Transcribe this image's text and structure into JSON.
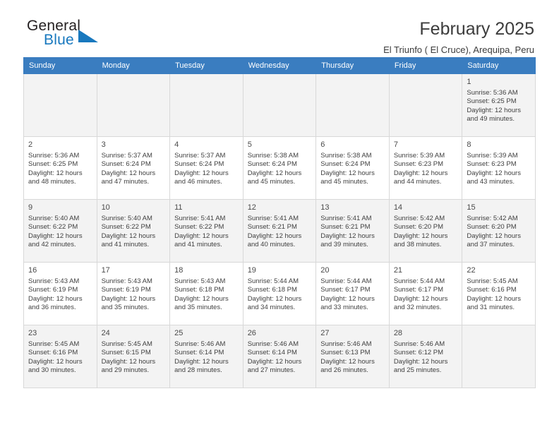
{
  "logo": {
    "primary_text": "General",
    "secondary_text": "Blue",
    "primary_color": "#231f20",
    "secondary_color": "#1878be"
  },
  "header": {
    "title": "February 2025",
    "subtitle": "El Triunfo ( El Cruce), Arequipa, Peru"
  },
  "colors": {
    "header_row_background": "#3a7dc0",
    "header_row_text": "#ffffff",
    "cell_border": "#d8d8d8",
    "shaded_row_background": "#f3f3f3"
  },
  "calendar": {
    "weekday_headers": [
      "Sunday",
      "Monday",
      "Tuesday",
      "Wednesday",
      "Thursday",
      "Friday",
      "Saturday"
    ],
    "weeks": [
      [
        {
          "day": "",
          "empty": true
        },
        {
          "day": "",
          "empty": true
        },
        {
          "day": "",
          "empty": true
        },
        {
          "day": "",
          "empty": true
        },
        {
          "day": "",
          "empty": true
        },
        {
          "day": "",
          "empty": true
        },
        {
          "day": "1",
          "sunrise": "Sunrise: 5:36 AM",
          "sunset": "Sunset: 6:25 PM",
          "daylight_line1": "Daylight: 12 hours",
          "daylight_line2": "and 49 minutes."
        }
      ],
      [
        {
          "day": "2",
          "sunrise": "Sunrise: 5:36 AM",
          "sunset": "Sunset: 6:25 PM",
          "daylight_line1": "Daylight: 12 hours",
          "daylight_line2": "and 48 minutes."
        },
        {
          "day": "3",
          "sunrise": "Sunrise: 5:37 AM",
          "sunset": "Sunset: 6:24 PM",
          "daylight_line1": "Daylight: 12 hours",
          "daylight_line2": "and 47 minutes."
        },
        {
          "day": "4",
          "sunrise": "Sunrise: 5:37 AM",
          "sunset": "Sunset: 6:24 PM",
          "daylight_line1": "Daylight: 12 hours",
          "daylight_line2": "and 46 minutes."
        },
        {
          "day": "5",
          "sunrise": "Sunrise: 5:38 AM",
          "sunset": "Sunset: 6:24 PM",
          "daylight_line1": "Daylight: 12 hours",
          "daylight_line2": "and 45 minutes."
        },
        {
          "day": "6",
          "sunrise": "Sunrise: 5:38 AM",
          "sunset": "Sunset: 6:24 PM",
          "daylight_line1": "Daylight: 12 hours",
          "daylight_line2": "and 45 minutes."
        },
        {
          "day": "7",
          "sunrise": "Sunrise: 5:39 AM",
          "sunset": "Sunset: 6:23 PM",
          "daylight_line1": "Daylight: 12 hours",
          "daylight_line2": "and 44 minutes."
        },
        {
          "day": "8",
          "sunrise": "Sunrise: 5:39 AM",
          "sunset": "Sunset: 6:23 PM",
          "daylight_line1": "Daylight: 12 hours",
          "daylight_line2": "and 43 minutes."
        }
      ],
      [
        {
          "day": "9",
          "sunrise": "Sunrise: 5:40 AM",
          "sunset": "Sunset: 6:22 PM",
          "daylight_line1": "Daylight: 12 hours",
          "daylight_line2": "and 42 minutes."
        },
        {
          "day": "10",
          "sunrise": "Sunrise: 5:40 AM",
          "sunset": "Sunset: 6:22 PM",
          "daylight_line1": "Daylight: 12 hours",
          "daylight_line2": "and 41 minutes."
        },
        {
          "day": "11",
          "sunrise": "Sunrise: 5:41 AM",
          "sunset": "Sunset: 6:22 PM",
          "daylight_line1": "Daylight: 12 hours",
          "daylight_line2": "and 41 minutes."
        },
        {
          "day": "12",
          "sunrise": "Sunrise: 5:41 AM",
          "sunset": "Sunset: 6:21 PM",
          "daylight_line1": "Daylight: 12 hours",
          "daylight_line2": "and 40 minutes."
        },
        {
          "day": "13",
          "sunrise": "Sunrise: 5:41 AM",
          "sunset": "Sunset: 6:21 PM",
          "daylight_line1": "Daylight: 12 hours",
          "daylight_line2": "and 39 minutes."
        },
        {
          "day": "14",
          "sunrise": "Sunrise: 5:42 AM",
          "sunset": "Sunset: 6:20 PM",
          "daylight_line1": "Daylight: 12 hours",
          "daylight_line2": "and 38 minutes."
        },
        {
          "day": "15",
          "sunrise": "Sunrise: 5:42 AM",
          "sunset": "Sunset: 6:20 PM",
          "daylight_line1": "Daylight: 12 hours",
          "daylight_line2": "and 37 minutes."
        }
      ],
      [
        {
          "day": "16",
          "sunrise": "Sunrise: 5:43 AM",
          "sunset": "Sunset: 6:19 PM",
          "daylight_line1": "Daylight: 12 hours",
          "daylight_line2": "and 36 minutes."
        },
        {
          "day": "17",
          "sunrise": "Sunrise: 5:43 AM",
          "sunset": "Sunset: 6:19 PM",
          "daylight_line1": "Daylight: 12 hours",
          "daylight_line2": "and 35 minutes."
        },
        {
          "day": "18",
          "sunrise": "Sunrise: 5:43 AM",
          "sunset": "Sunset: 6:18 PM",
          "daylight_line1": "Daylight: 12 hours",
          "daylight_line2": "and 35 minutes."
        },
        {
          "day": "19",
          "sunrise": "Sunrise: 5:44 AM",
          "sunset": "Sunset: 6:18 PM",
          "daylight_line1": "Daylight: 12 hours",
          "daylight_line2": "and 34 minutes."
        },
        {
          "day": "20",
          "sunrise": "Sunrise: 5:44 AM",
          "sunset": "Sunset: 6:17 PM",
          "daylight_line1": "Daylight: 12 hours",
          "daylight_line2": "and 33 minutes."
        },
        {
          "day": "21",
          "sunrise": "Sunrise: 5:44 AM",
          "sunset": "Sunset: 6:17 PM",
          "daylight_line1": "Daylight: 12 hours",
          "daylight_line2": "and 32 minutes."
        },
        {
          "day": "22",
          "sunrise": "Sunrise: 5:45 AM",
          "sunset": "Sunset: 6:16 PM",
          "daylight_line1": "Daylight: 12 hours",
          "daylight_line2": "and 31 minutes."
        }
      ],
      [
        {
          "day": "23",
          "sunrise": "Sunrise: 5:45 AM",
          "sunset": "Sunset: 6:16 PM",
          "daylight_line1": "Daylight: 12 hours",
          "daylight_line2": "and 30 minutes."
        },
        {
          "day": "24",
          "sunrise": "Sunrise: 5:45 AM",
          "sunset": "Sunset: 6:15 PM",
          "daylight_line1": "Daylight: 12 hours",
          "daylight_line2": "and 29 minutes."
        },
        {
          "day": "25",
          "sunrise": "Sunrise: 5:46 AM",
          "sunset": "Sunset: 6:14 PM",
          "daylight_line1": "Daylight: 12 hours",
          "daylight_line2": "and 28 minutes."
        },
        {
          "day": "26",
          "sunrise": "Sunrise: 5:46 AM",
          "sunset": "Sunset: 6:14 PM",
          "daylight_line1": "Daylight: 12 hours",
          "daylight_line2": "and 27 minutes."
        },
        {
          "day": "27",
          "sunrise": "Sunrise: 5:46 AM",
          "sunset": "Sunset: 6:13 PM",
          "daylight_line1": "Daylight: 12 hours",
          "daylight_line2": "and 26 minutes."
        },
        {
          "day": "28",
          "sunrise": "Sunrise: 5:46 AM",
          "sunset": "Sunset: 6:12 PM",
          "daylight_line1": "Daylight: 12 hours",
          "daylight_line2": "and 25 minutes."
        },
        {
          "day": "",
          "empty": true
        }
      ]
    ]
  }
}
